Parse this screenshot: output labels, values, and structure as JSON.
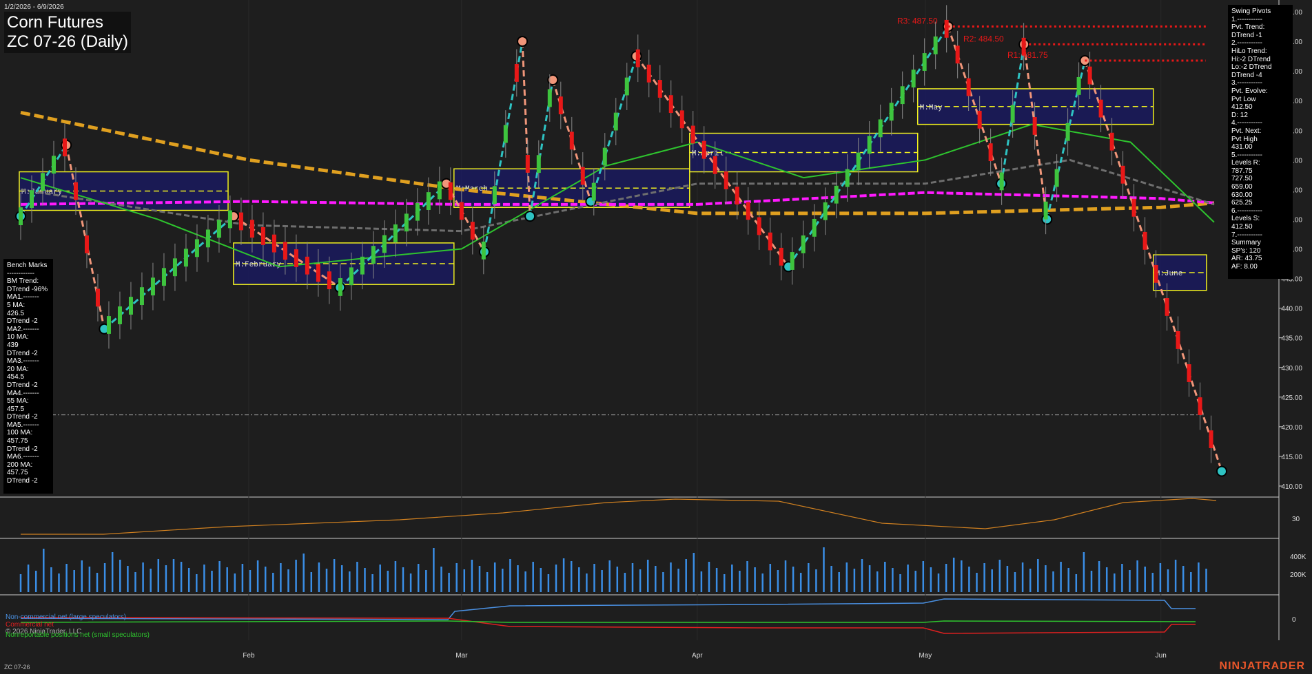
{
  "header": {
    "date_range": "1/2/2026 - 6/9/2026",
    "title_line1": "Corn Futures",
    "title_line2": "ZC 07-26 (Daily)"
  },
  "colors": {
    "background": "#1e1e1e",
    "up_candle": "#3ec43e",
    "down_candle": "#e81818",
    "swing_up": "#2ec3c3",
    "swing_down": "#f0967a",
    "ma_green": "#2ec42e",
    "ma_gray": "#6e6e6e",
    "ma_magenta": "#ff1aff",
    "ma_orange": "#e0a020",
    "band": "#1a1a5e",
    "band_border": "#f0f020",
    "brand": "#e8562a"
  },
  "bench_marks": {
    "lines": [
      "Bench Marks",
      "------------",
      "BM Trend:",
      "DTrend -96%",
      "MA1.-------",
      "5 MA:",
      "426.5",
      "DTrend -2",
      "MA2.-------",
      "10 MA:",
      "439",
      "DTrend -2",
      "MA3.-------",
      "20 MA:",
      "454.5",
      "DTrend -2",
      "MA4.-------",
      "55 MA:",
      "457.5",
      "DTrend -2",
      "MA5.-------",
      "100 MA:",
      "457.75",
      "DTrend -2",
      "MA6.-------",
      "200 MA:",
      "457.75",
      "DTrend -2"
    ]
  },
  "swing_pivots": {
    "lines": [
      "Swing Pivots",
      "1.-----------",
      "Pvt. Trend:",
      "DTrend -1",
      "2.-----------",
      "HiLo Trend:",
      "Hi:-2 DTrend",
      "Lo:-2 DTrend",
      "DTrend -4",
      "3.-----------",
      "Pvt. Evolve:",
      "Pvt Low",
      "412.50",
      "D: 12",
      "4.-----------",
      "Pvt. Next:",
      "Pvt High",
      "431.00",
      "5.-----------",
      "Levels R:",
      "787.75",
      "727.50",
      "659.00",
      "630.00",
      "625.25",
      "6.-----------",
      "Levels S:",
      "412.50",
      "7.-----------",
      "Summary",
      "SP's: 120",
      "AR: 43.75",
      "AF: 8.00"
    ]
  },
  "resistance_labels": [
    {
      "label": "R3: 487.50",
      "price": 487.5
    },
    {
      "label": "R2: 484.50",
      "price": 484.5
    },
    {
      "label": "R1: 481.75",
      "price": 481.75
    }
  ],
  "month_band_labels": [
    "M:January",
    "M:February",
    "M:March",
    "M:April",
    "M:May",
    "M:June"
  ],
  "legend": {
    "noncommercial": "Non-commercial net (large speculators)",
    "commercial": "Commercial net",
    "copyright": "© 2026 NinjaTrader, LLC",
    "nonreportable": "Nonreportable positions net (small speculators)"
  },
  "footer_symbol": "ZC 07-26",
  "brand": "NINJATRADER",
  "chart_data": {
    "type": "candlestick",
    "title": "ZC 07-26 (Daily)",
    "price_axis": {
      "ticks": [
        490,
        485,
        480,
        475,
        470,
        465,
        460,
        455,
        450,
        445,
        440,
        435,
        430,
        425,
        420,
        415,
        410
      ],
      "ylim": [
        407.5,
        491
      ]
    },
    "x_axis": {
      "tick_labels": [
        "Feb",
        "Mar",
        "Apr",
        "May",
        "Jun"
      ]
    },
    "current_price_line": 422.0,
    "swing_pivots_path": [
      {
        "date": "2026-01-02",
        "price": 455.5,
        "type": "low"
      },
      {
        "date": "2026-01-08",
        "price": 467.5,
        "type": "high"
      },
      {
        "date": "2026-01-13",
        "price": 436.5,
        "type": "low"
      },
      {
        "date": "2026-01-30",
        "price": 455.5,
        "type": "high"
      },
      {
        "date": "2026-02-13",
        "price": 443.5,
        "type": "low"
      },
      {
        "date": "2026-02-27",
        "price": 461.0,
        "type": "high"
      },
      {
        "date": "2026-03-04",
        "price": 449.5,
        "type": "low"
      },
      {
        "date": "2026-03-09",
        "price": 485.0,
        "type": "high"
      },
      {
        "date": "2026-03-10",
        "price": 455.5,
        "type": "low"
      },
      {
        "date": "2026-03-13",
        "price": 478.5,
        "type": "high"
      },
      {
        "date": "2026-03-18",
        "price": 458.0,
        "type": "low"
      },
      {
        "date": "2026-03-24",
        "price": 482.5,
        "type": "high"
      },
      {
        "date": "2026-04-13",
        "price": 447.0,
        "type": "low"
      },
      {
        "date": "2026-05-04",
        "price": 487.5,
        "type": "high"
      },
      {
        "date": "2026-05-11",
        "price": 461.0,
        "type": "low"
      },
      {
        "date": "2026-05-14",
        "price": 484.5,
        "type": "high"
      },
      {
        "date": "2026-05-17",
        "price": 455.0,
        "type": "low"
      },
      {
        "date": "2026-05-22",
        "price": 481.75,
        "type": "high"
      },
      {
        "date": "2026-06-09",
        "price": 412.5,
        "type": "low"
      }
    ],
    "month_bands": [
      {
        "label": "M:January",
        "high": 463.0,
        "low": 456.5,
        "mid": 459.75
      },
      {
        "label": "M:February",
        "high": 451.0,
        "low": 444.0,
        "mid": 447.5
      },
      {
        "label": "M:March",
        "high": 463.5,
        "low": 457.0,
        "mid": 460.25
      },
      {
        "label": "M:April",
        "high": 469.5,
        "low": 463.0,
        "mid": 466.25
      },
      {
        "label": "M:May",
        "high": 477.0,
        "low": 471.0,
        "mid": 474.0
      },
      {
        "label": "M:June",
        "high": 449.0,
        "low": 443.0,
        "mid": 446.0
      }
    ],
    "moving_averages": [
      {
        "name": "5 MA",
        "value": 426.5
      },
      {
        "name": "10 MA",
        "value": 439
      },
      {
        "name": "20 MA",
        "value": 454.5
      },
      {
        "name": "55 MA",
        "value": 457.5
      },
      {
        "name": "100 MA",
        "value": 457.75
      },
      {
        "name": "200 MA",
        "value": 457.75
      }
    ],
    "indicator_panel_1": {
      "ticks": [
        30
      ]
    },
    "volume_panel": {
      "ticks": [
        "400K",
        "200K"
      ]
    },
    "cot_panel": {
      "ticks": [
        0
      ]
    }
  }
}
